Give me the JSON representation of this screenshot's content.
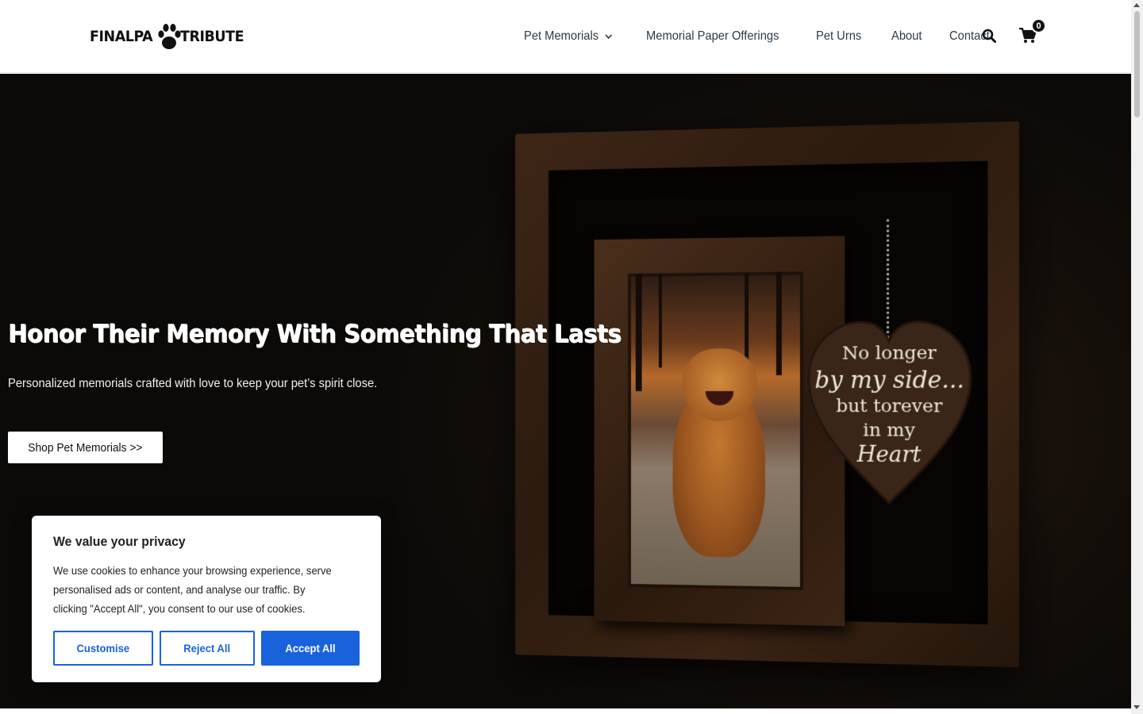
{
  "brand": {
    "logo_left": "FINALPA",
    "logo_right": "TRIBUTE",
    "logo_icon": "paw-icon"
  },
  "nav": {
    "items": [
      {
        "label": "Pet Memorials",
        "has_dropdown": true
      },
      {
        "label": "Memorial Paper Offerings",
        "has_dropdown": false
      },
      {
        "label": "Pet Urns",
        "has_dropdown": false
      },
      {
        "label": "About",
        "has_dropdown": false
      },
      {
        "label": "Contact",
        "has_dropdown": false
      }
    ],
    "search_icon": "search-icon",
    "cart_icon": "shopping-cart-icon",
    "cart_count": "0"
  },
  "hero": {
    "title": "Honor Their Memory With Something That Lasts",
    "subtitle": "Personalized memorials crafted with love to keep your pet’s spirit close.",
    "cta_label": "Shop Pet Memorials >>",
    "heart_plaque": {
      "line1": "No longer",
      "line2": "by my side...",
      "line3": "but torever",
      "line4": "in my",
      "line5": "Heart"
    }
  },
  "cookie": {
    "title": "We value your privacy",
    "text": "We use cookies to enhance your browsing experience, serve personalised ads or content, and analyse our traffic. By clicking \"Accept All\", you consent to our use of cookies.",
    "customise_label": "Customise",
    "reject_label": "Reject All",
    "accept_label": "Accept All",
    "accent_color": "#1863dc"
  }
}
